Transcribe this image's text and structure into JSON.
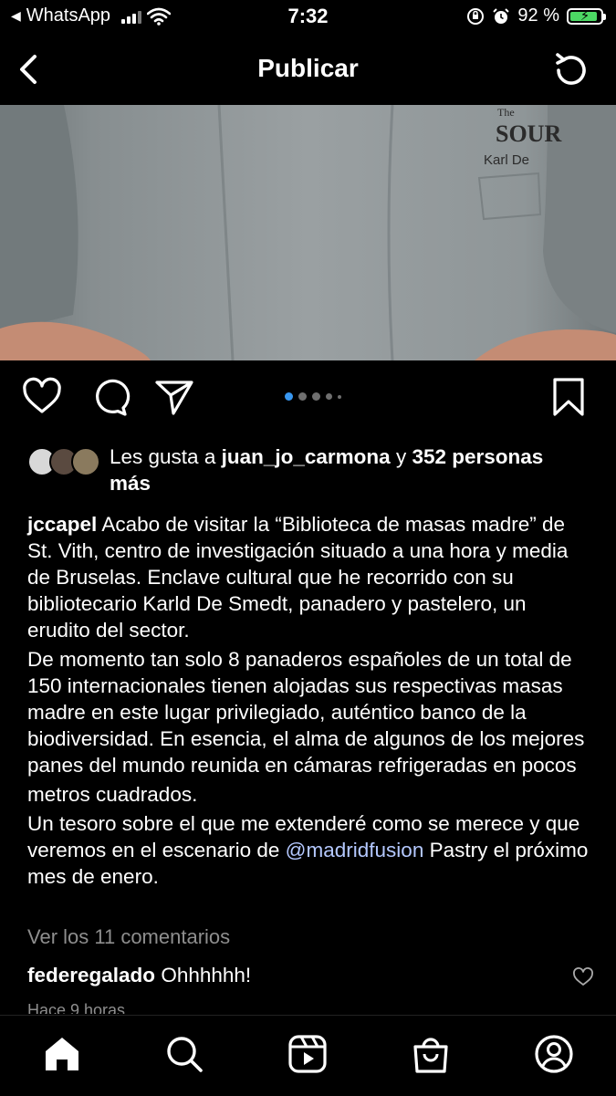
{
  "status_bar": {
    "back_app": "WhatsApp",
    "time": "7:32",
    "battery_percent": "92 %",
    "battery_level": 0.92
  },
  "header": {
    "title": "Publicar"
  },
  "carousel": {
    "slide_count": 5,
    "active_index": 0
  },
  "likes": {
    "prefix": "Les gusta a",
    "user": "juan_jo_carmona",
    "connector": "y",
    "others": "352 personas más"
  },
  "caption": {
    "username": "jccapel",
    "p1": "Acabo de visitar la “Biblioteca de masas madre” de St. Vith, centro de investigación situado a una hora y media de Bruselas. Enclave cultural que he recorrido con su bibliotecario Karld De Smedt, panadero y pastelero, un erudito del sector.",
    "p2": "De momento tan solo 8 panaderos españoles de un total de 150 internacionales tienen alojadas sus respectivas masas madre en este lugar privilegiado, auténtico banco de la biodiversidad. En esencia, el alma de algunos de los mejores panes del mundo reunida en cámaras refrigeradas en pocos",
    "p2b": "metros cuadrados.",
    "p3": "Un tesoro sobre el que me extenderé como se merece y que veremos en el escenario de",
    "mention": "@madridfusion",
    "p3_end": "Pastry el próximo mes de enero."
  },
  "comments": {
    "view_all": "Ver los 11 comentarios",
    "items": [
      {
        "username": "federegalado",
        "text": "Ohhhhhh!",
        "time": "Hace 9 horas"
      }
    ]
  },
  "photo_text": {
    "logo_line1": "The",
    "logo_line2": "SOUR",
    "name": "Karl De"
  }
}
